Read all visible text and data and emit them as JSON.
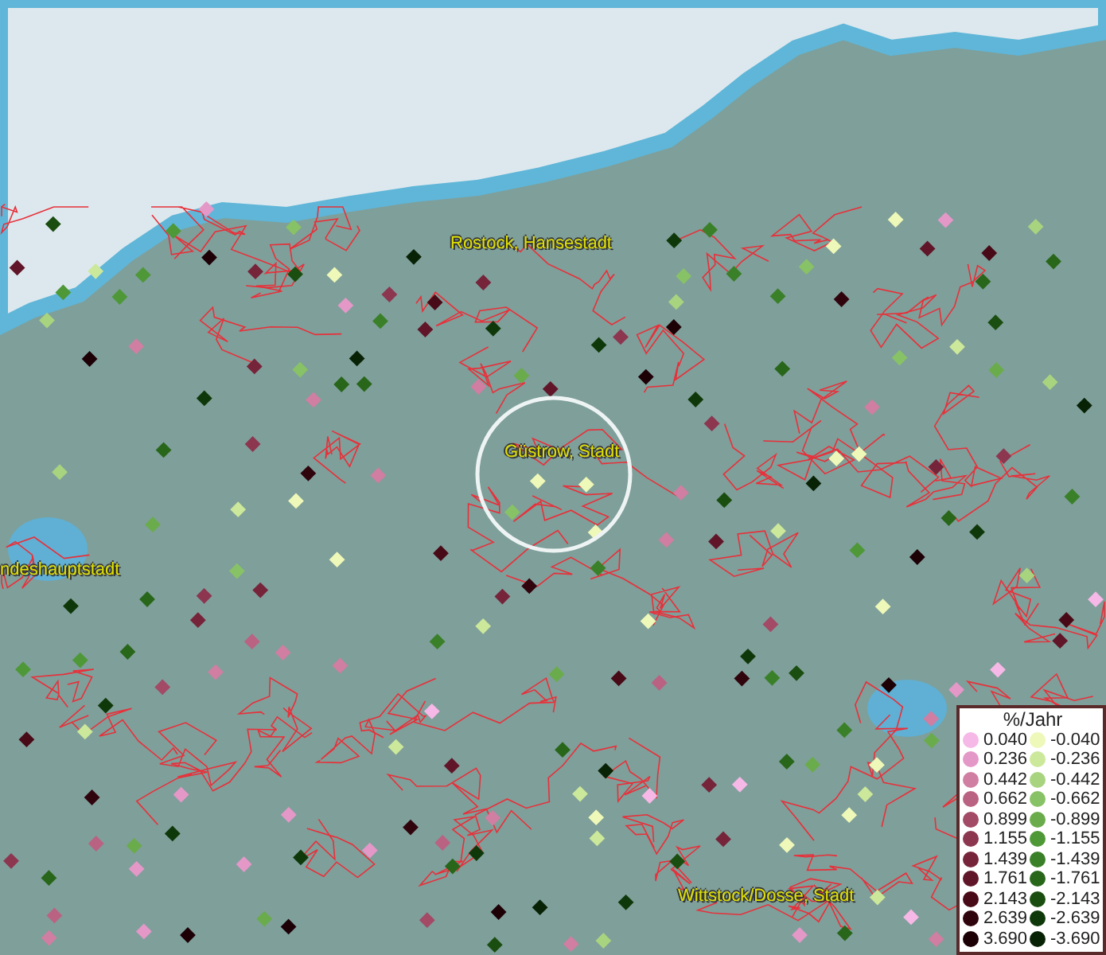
{
  "map": {
    "places": [
      {
        "name": "Rostock, Hansestadt"
      },
      {
        "name": "Güstrow, Stadt"
      },
      {
        "name": "ndeshauptstadt"
      },
      {
        "name": "Wittstock/Dosse, Stadt"
      }
    ]
  },
  "legend": {
    "title": "%/Jahr",
    "entries": [
      {
        "value": "0.040",
        "color": "#f6b8e6"
      },
      {
        "value": "0.236",
        "color": "#e498c8"
      },
      {
        "value": "0.442",
        "color": "#d07ea2"
      },
      {
        "value": "0.662",
        "color": "#ba6282"
      },
      {
        "value": "0.899",
        "color": "#a24a66"
      },
      {
        "value": "1.155",
        "color": "#8c3650"
      },
      {
        "value": "1.439",
        "color": "#76243a"
      },
      {
        "value": "1.761",
        "color": "#601628"
      },
      {
        "value": "2.143",
        "color": "#480a16"
      },
      {
        "value": "2.639",
        "color": "#30040c"
      },
      {
        "value": "3.690",
        "color": "#1c0006"
      },
      {
        "value": "-0.040",
        "color": "#eef8b8"
      },
      {
        "value": "-0.236",
        "color": "#cce89a"
      },
      {
        "value": "-0.442",
        "color": "#a8d480"
      },
      {
        "value": "-0.662",
        "color": "#88c266"
      },
      {
        "value": "-0.899",
        "color": "#6aac4c"
      },
      {
        "value": "-1.155",
        "color": "#4e9838"
      },
      {
        "value": "-1.439",
        "color": "#3a8028"
      },
      {
        "value": "-1.761",
        "color": "#28661a"
      },
      {
        "value": "-2.143",
        "color": "#1a4e10"
      },
      {
        "value": "-2.639",
        "color": "#0f380a"
      },
      {
        "value": "-3.690",
        "color": "#082206"
      }
    ]
  }
}
